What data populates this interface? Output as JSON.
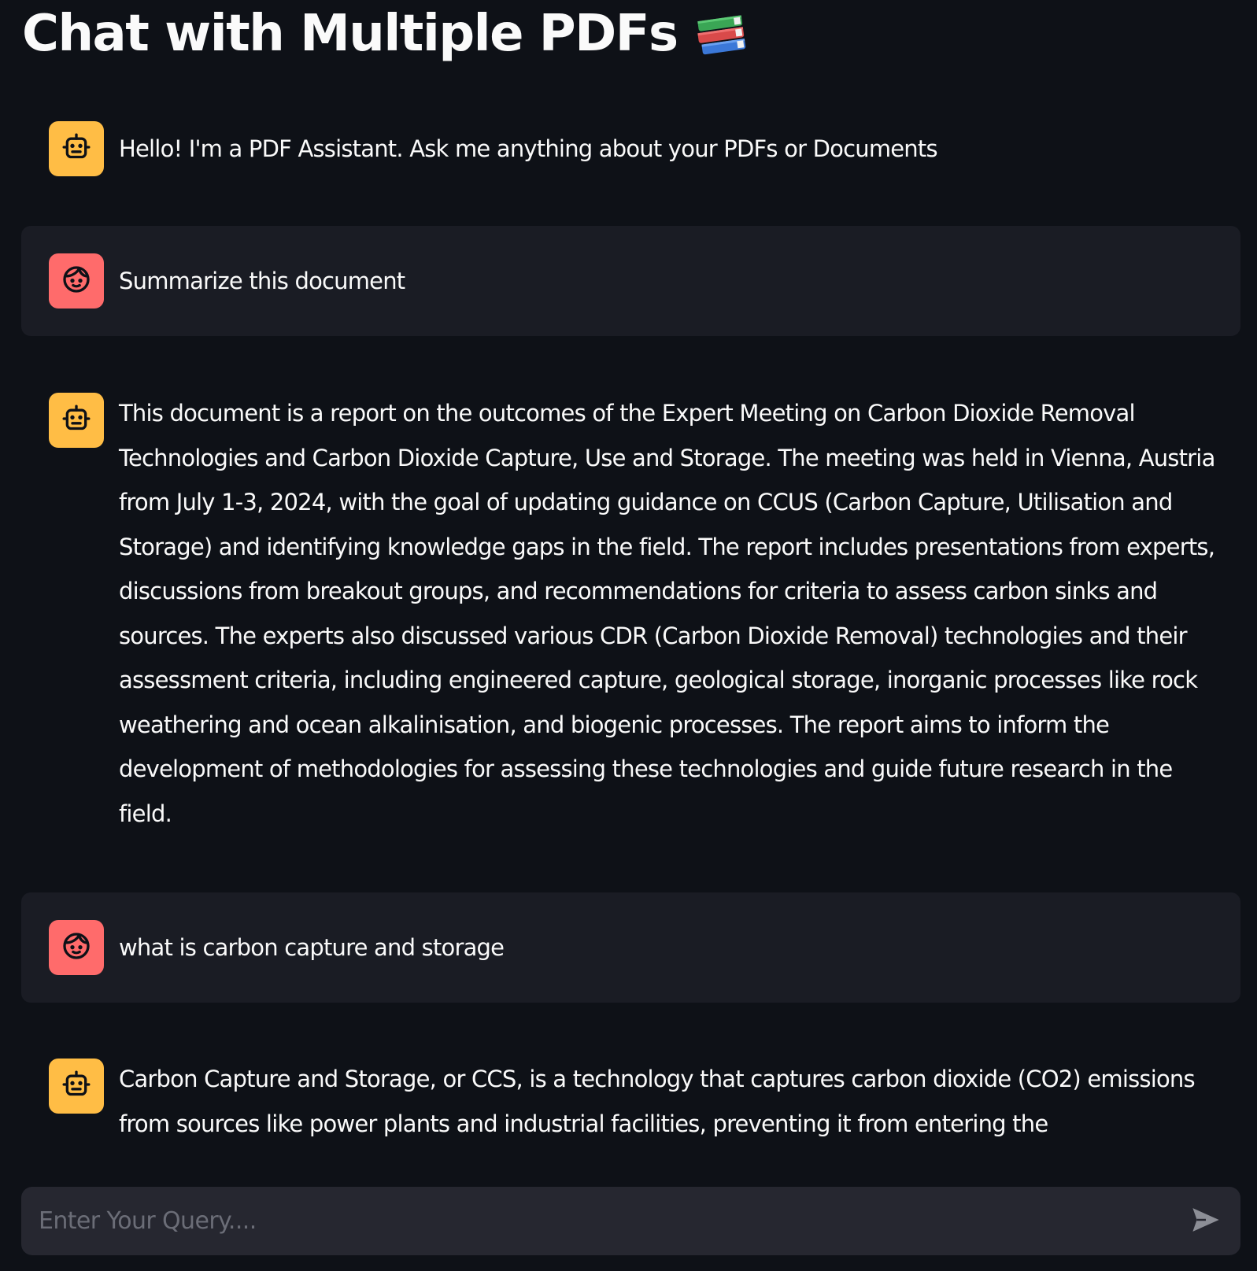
{
  "page": {
    "title": "Chat with Multiple PDFs"
  },
  "colors": {
    "background": "#0e1117",
    "user_bubble": "#1a1c24",
    "bot_avatar": "#ffbd45",
    "user_avatar": "#ff6b6b",
    "input_background": "#262730"
  },
  "messages": [
    {
      "role": "assistant",
      "avatar_icon": "robot-icon",
      "text": "Hello! I'm a PDF Assistant. Ask me anything about your PDFs or Documents"
    },
    {
      "role": "user",
      "avatar_icon": "face-icon",
      "text": "Summarize this document"
    },
    {
      "role": "assistant",
      "avatar_icon": "robot-icon",
      "text": "This document is a report on the outcomes of the Expert Meeting on Carbon Dioxide Removal Technologies and Carbon Dioxide Capture, Use and Storage. The meeting was held in Vienna, Austria from July 1-3, 2024, with the goal of updating guidance on CCUS (Carbon Capture, Utilisation and Storage) and identifying knowledge gaps in the field. The report includes presentations from experts, discussions from breakout groups, and recommendations for criteria to assess carbon sinks and sources. The experts also discussed various CDR (Carbon Dioxide Removal) technologies and their assessment criteria, including engineered capture, geological storage, inorganic processes like rock weathering and ocean alkalinisation, and biogenic processes. The report aims to inform the development of methodologies for assessing these technologies and guide future research in the field."
    },
    {
      "role": "user",
      "avatar_icon": "face-icon",
      "text": "what is carbon capture and storage"
    },
    {
      "role": "assistant",
      "avatar_icon": "robot-icon",
      "text": "Carbon Capture and Storage, or CCS, is a technology that captures carbon dioxide (CO2) emissions from sources like power plants and industrial facilities, preventing it from entering the"
    }
  ],
  "input": {
    "placeholder": "Enter Your Query....",
    "value": "",
    "send_icon": "send-icon"
  }
}
